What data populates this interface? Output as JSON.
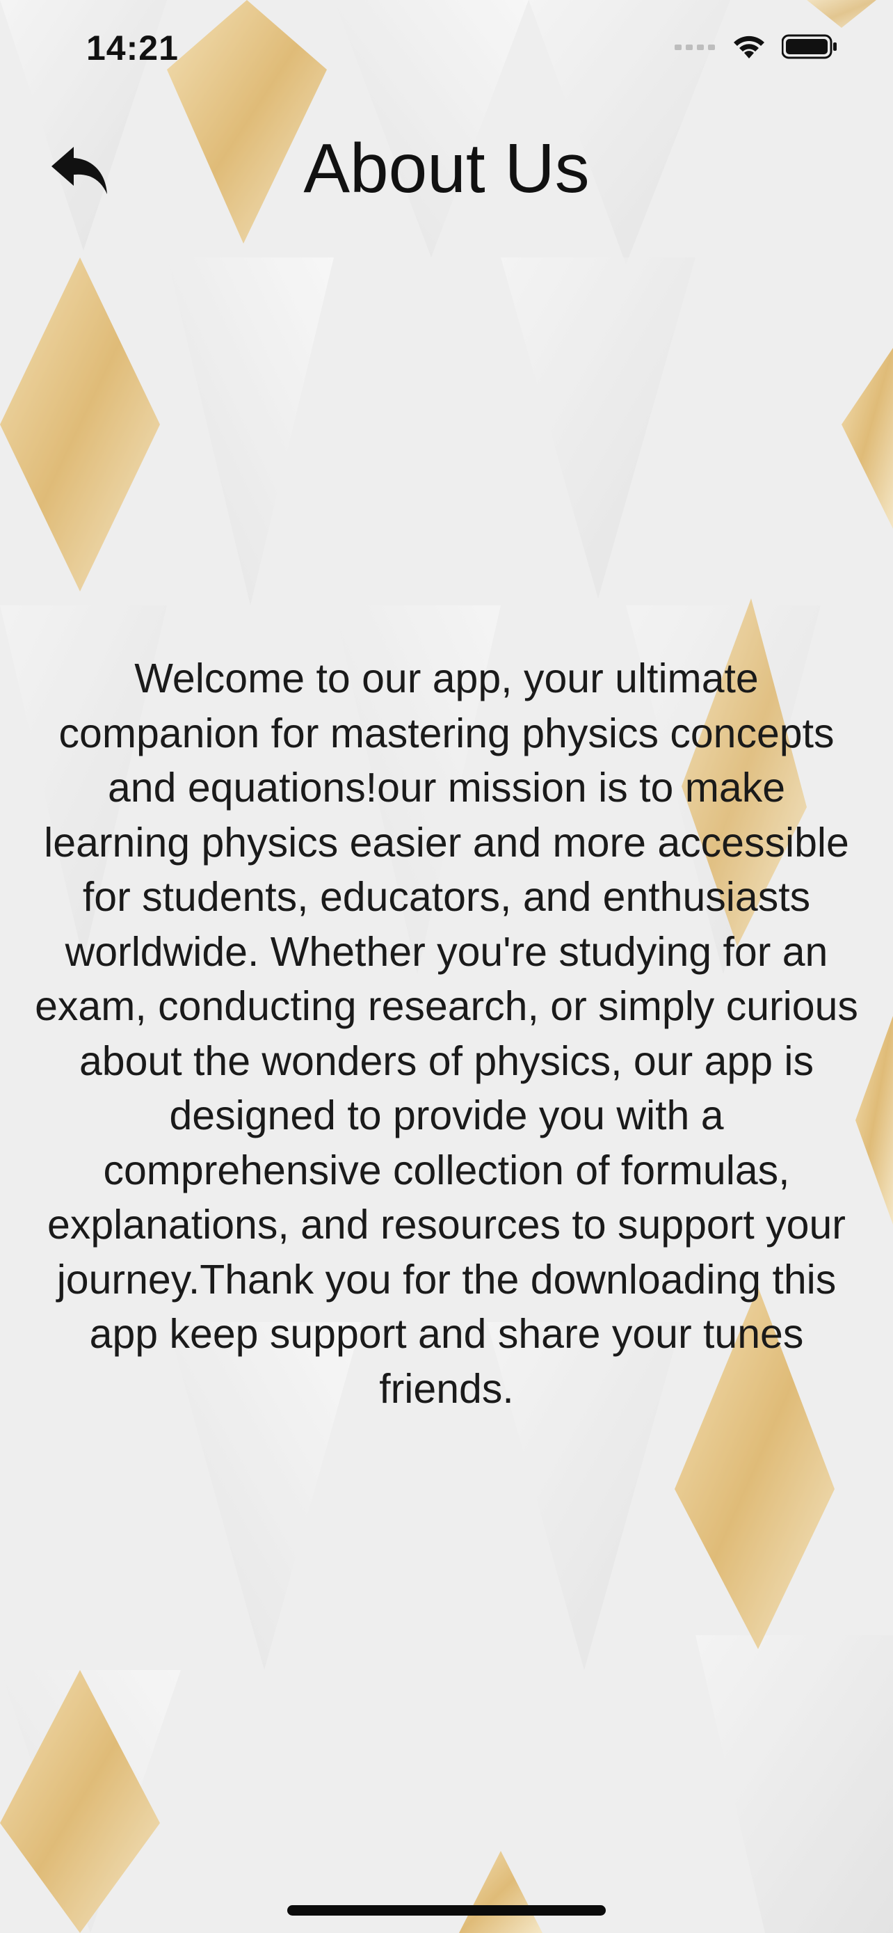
{
  "status_bar": {
    "time": "14:21",
    "icons": [
      "signal-icon",
      "wifi-icon",
      "battery-icon"
    ]
  },
  "nav": {
    "back_icon": "reply-arrow-icon",
    "title": "About Us"
  },
  "content": {
    "about_text": "Welcome to our app, your ultimate companion for mastering physics concepts and equations!our mission is to make learning physics easier and more accessible for students, educators, and enthusiasts worldwide. Whether you're studying for an exam, conducting research, or simply curious about the wonders of physics, our app is designed to provide you with a comprehensive collection of formulas, explanations, and resources to support your journey.Thank you for the downloading this app keep support and share your tunes friends."
  },
  "colors": {
    "background": "#ededed",
    "gold_accent": "#d9a94f",
    "text": "#1a1a1a"
  }
}
